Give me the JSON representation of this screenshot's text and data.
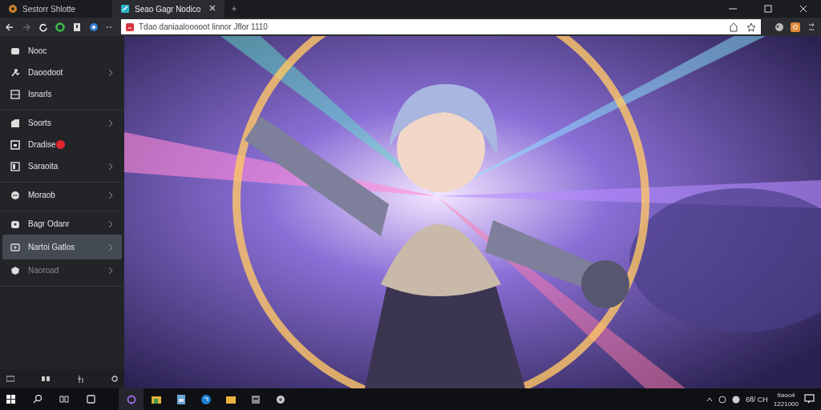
{
  "tabs": [
    {
      "title": "Sestorr Shlotte",
      "selected": false
    },
    {
      "title": "Seao Gagr Nodico",
      "selected": true
    }
  ],
  "address_bar": {
    "url": "Tdao daniaalooooot linnor Jflor 1110"
  },
  "sidebar": {
    "groups": [
      {
        "items": [
          {
            "label": "Nooc",
            "has_submenu": false,
            "selected": false,
            "disabled": false,
            "badge": false
          },
          {
            "label": "Daoodoot",
            "has_submenu": true,
            "selected": false,
            "disabled": false,
            "badge": false
          },
          {
            "label": "Isnarls",
            "has_submenu": false,
            "selected": false,
            "disabled": false,
            "badge": false
          }
        ]
      },
      {
        "items": [
          {
            "label": "Soorts",
            "has_submenu": true,
            "selected": false,
            "disabled": false,
            "badge": false
          },
          {
            "label": "Dradise",
            "has_submenu": false,
            "selected": false,
            "disabled": false,
            "badge": true
          },
          {
            "label": "Saraoita",
            "has_submenu": true,
            "selected": false,
            "disabled": false,
            "badge": false
          }
        ]
      },
      {
        "items": [
          {
            "label": "Moraob",
            "has_submenu": true,
            "selected": false,
            "disabled": false,
            "badge": false
          }
        ]
      },
      {
        "items": [
          {
            "label": "Bagr Odanr",
            "has_submenu": true,
            "selected": false,
            "disabled": false,
            "badge": false
          },
          {
            "label": "Nartoi Gatlos",
            "has_submenu": true,
            "selected": true,
            "disabled": false,
            "badge": false
          },
          {
            "label": "Naoroad",
            "has_submenu": true,
            "selected": false,
            "disabled": true,
            "badge": false
          }
        ]
      }
    ]
  },
  "taskbar": {
    "tray_text": "6fl/ CH",
    "clock": {
      "time": "9aoo4",
      "date": "1221000"
    }
  }
}
